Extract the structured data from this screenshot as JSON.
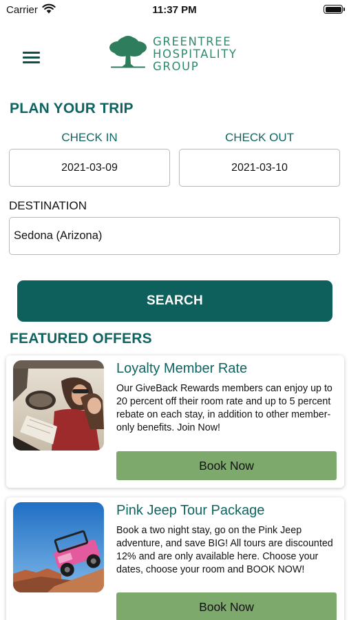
{
  "status_bar": {
    "carrier": "Carrier",
    "time": "11:37 PM"
  },
  "brand": {
    "line1": "GREENTREE",
    "line2": "HOSPITALITY",
    "line3": "GROUP"
  },
  "plan": {
    "title": "PLAN YOUR TRIP",
    "checkin_label": "CHECK IN",
    "checkin_value": "2021-03-09",
    "checkout_label": "CHECK OUT",
    "checkout_value": "2021-03-10",
    "destination_label": "DESTINATION",
    "destination_value": "Sedona (Arizona)",
    "search_label": "SEARCH"
  },
  "offers": {
    "title": "FEATURED OFFERS",
    "items": [
      {
        "title": "Loyalty Member Rate",
        "body": "Our GiveBack Rewards members can enjoy up to 20 percent off their room rate and up to 5 percent rebate on each stay, in addition to other member-only benefits. Join Now!",
        "button": "Book Now"
      },
      {
        "title": "Pink Jeep Tour Package",
        "body": "Book a two night stay, go on the Pink Jeep adventure, and save BIG! All tours are discounted 12% and are only available here. Choose your dates, choose your room and BOOK NOW!",
        "button": "Book Now"
      }
    ]
  },
  "colors": {
    "brand_teal": "#0e605d",
    "brand_green": "#2f8a6c",
    "book_button": "#7daa6c"
  }
}
